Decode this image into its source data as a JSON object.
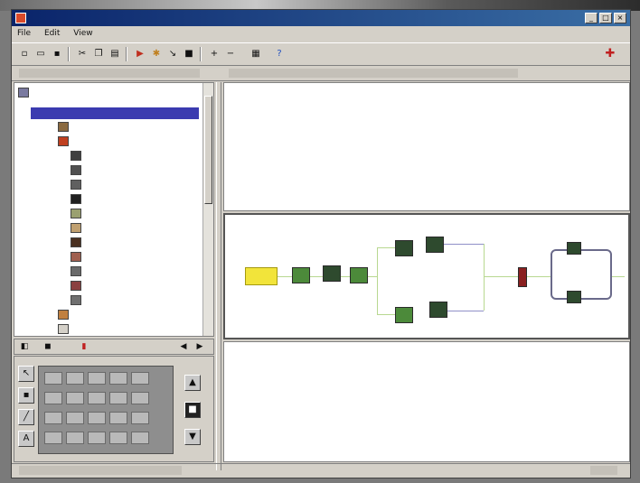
{
  "window": {
    "title": ""
  },
  "menubar": {
    "items": [
      "File",
      "Edit",
      "View"
    ]
  },
  "toolbar": {
    "icons": [
      "new-icon",
      "open-icon",
      "save-icon",
      "cut-icon",
      "copy-icon",
      "paste-icon",
      "run-icon",
      "debug-icon",
      "step-icon",
      "stop-icon",
      "zoom-in-icon",
      "zoom-out-icon",
      "properties-icon",
      "help-icon",
      "exit-icon"
    ]
  },
  "tree": {
    "root_label": "",
    "rows": [
      "",
      "",
      "",
      "",
      "",
      "",
      "",
      "",
      "",
      "",
      "",
      "",
      "",
      "",
      "",
      "",
      "",
      "",
      "",
      ""
    ]
  },
  "palette": {
    "tools": [
      "pointer-tool-icon",
      "node-tool-icon",
      "edge-tool-icon",
      "text-tool-icon"
    ]
  },
  "colors": {
    "title_bar": "#0a246a",
    "tree_selection": "#3b3bb0",
    "highlight_node": "#f2e43a",
    "node_green": "#4c8a3a",
    "stop_node": "#8a2020"
  }
}
